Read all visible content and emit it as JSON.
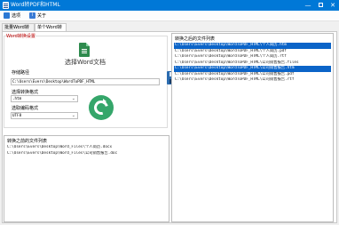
{
  "window": {
    "title": "Word转PDF和HTML",
    "min_glyph": "—",
    "max_glyph": "",
    "close_glyph": "✕"
  },
  "menu": [
    {
      "label": "选项",
      "icon": "settings-icon",
      "glyph": ""
    },
    {
      "label": "关于",
      "icon": "info-icon",
      "glyph": "i"
    }
  ],
  "tabs": [
    {
      "label": "批量Word转换",
      "active": false
    },
    {
      "label": "单个Word转换",
      "active": true
    }
  ],
  "settings": {
    "group_title": "Word转换设置",
    "choose_word_label": "选择Word文档",
    "save_path_label": "存储路径",
    "save_path_value": "C:\\Users\\Evers\\Desktop\\WordToPDF_HTML",
    "format_label": "选择转换格式",
    "format_value": ".htm",
    "encoding_label": "选取编码格式",
    "encoding_value": "UTF8",
    "chevron": "⌄"
  },
  "before_list": {
    "title": "转换之前的文件列表",
    "rows": [
      "C:\\Users\\Evers\\Desktop\\Word_Files\\个人简历.docx",
      "C:\\Users\\Evers\\Desktop\\Word_Files\\公司销售报告.doc"
    ]
  },
  "after_list": {
    "title": "转换之后的文件列表",
    "rows": [
      {
        "text": "C:\\Users\\Evers\\Desktop\\WordToPDF_HTML\\个人简历.htm",
        "selected": true
      },
      {
        "text": "C:\\Users\\Evers\\Desktop\\WordToPDF_HTML\\个人简历.pdf",
        "selected": false
      },
      {
        "text": "C:\\Users\\Evers\\Desktop\\WordToPDF_HTML\\个人简历.rtf",
        "selected": false
      },
      {
        "text": "C:\\Users\\Evers\\Desktop\\WordToPDF_HTML\\公司销售报告.files",
        "selected": false
      },
      {
        "text": "C:\\Users\\Evers\\Desktop\\WordToPDF_HTML\\公司销售报告.htm",
        "selected": true
      },
      {
        "text": "C:\\Users\\Evers\\Desktop\\WordToPDF_HTML\\公司销售报告.pdf",
        "selected": false
      },
      {
        "text": "C:\\Users\\Evers\\Desktop\\WordToPDF_HTML\\公司销售报告.rtf",
        "selected": false
      }
    ]
  },
  "colors": {
    "titlebar": "#0078d7",
    "selection": "#0b64c8",
    "group_title": "#c00000",
    "convert_button": "#35a66a",
    "word_icon": "#2e8b4e"
  }
}
